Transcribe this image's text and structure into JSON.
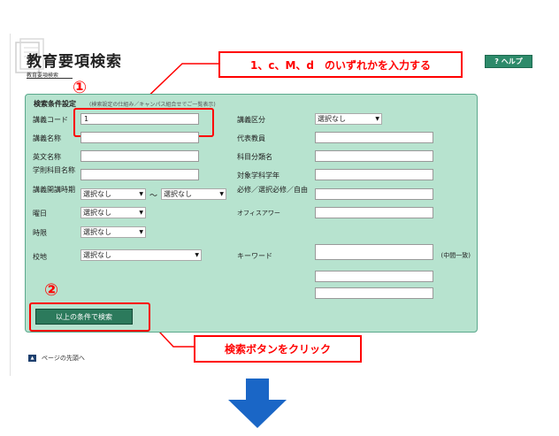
{
  "header": {
    "title": "教育要項検索",
    "subtitle": "教育要項検索",
    "help_label": "? ヘルプ"
  },
  "callouts": {
    "top": "1、c、M、d　のいずれかを入力する",
    "bottom": "検索ボタンをクリック",
    "num1": "①",
    "num2": "②"
  },
  "form": {
    "section_title": "検索条件設定",
    "section_note": "(検索設定の仕組み／キャンパス組合せでご一覧表示)",
    "labels": {
      "course_code": "講義コード",
      "course_name": "講義名称",
      "english_name": "英文名称",
      "subject_name": "学則科目名称",
      "period": "講義開講時期",
      "day": "曜日",
      "hour": "時限",
      "campus": "校地",
      "course_category": "講義区分",
      "instructor": "代表教員",
      "field_name": "科目分類名",
      "target_year": "対象学科学年",
      "required": "必修／選択必修／自由",
      "office_hour": "オフィスアワー",
      "keyword": "キーワード",
      "keyword_note": "(中間一致)"
    },
    "values": {
      "course_code": "1"
    },
    "selects": {
      "period_from": "選択なし",
      "period_to": "選択なし",
      "day": "選択なし",
      "hour": "選択なし",
      "campus": "選択なし",
      "course_category": "選択なし"
    },
    "tilde": "～",
    "search_button": "以上の条件で検索"
  },
  "footer": {
    "page_top": "ページの先頭へ"
  },
  "colors": {
    "panel_bg": "#b7e3cf",
    "accent_red": "#ff0000",
    "arrow_blue": "#1a66c6",
    "button_green": "#2c7a5c"
  }
}
